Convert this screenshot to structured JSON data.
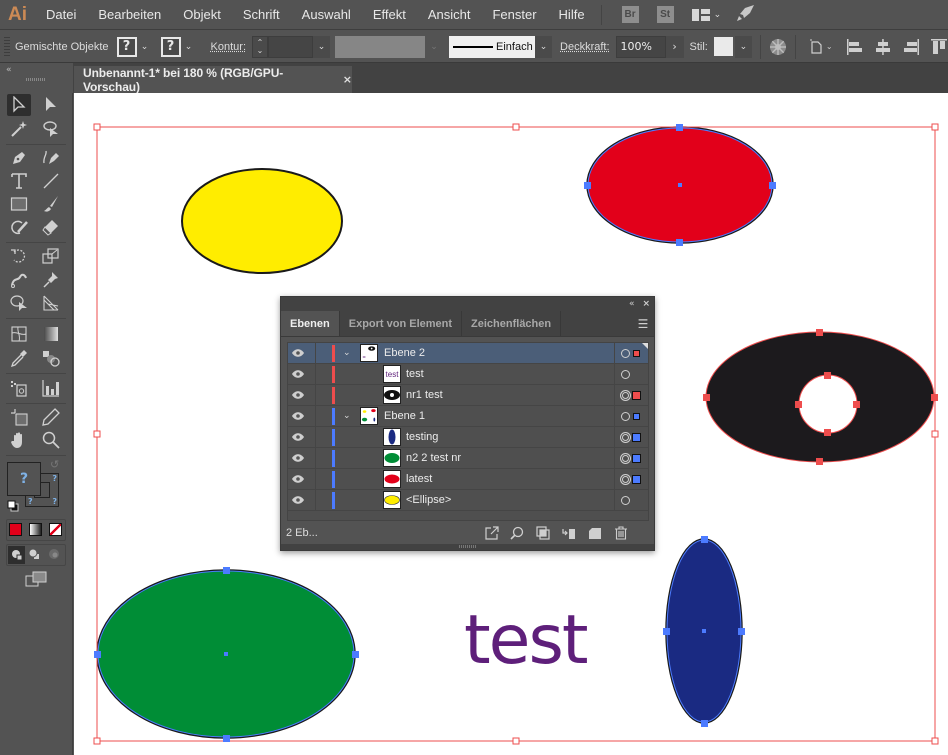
{
  "app": {
    "logo": "Ai"
  },
  "menu": [
    "Datei",
    "Bearbeiten",
    "Objekt",
    "Schrift",
    "Auswahl",
    "Effekt",
    "Ansicht",
    "Fenster",
    "Hilfe"
  ],
  "app_badges": {
    "bridge": "Br",
    "stock": "St"
  },
  "control_bar": {
    "selection_label": "Gemischte Objekte",
    "fill_value": "?",
    "stroke_value": "?",
    "stroke_label": "Kontur:",
    "stroke_weight": "",
    "stroke_profile": "Einfach",
    "opacity_label": "Deckkraft:",
    "opacity_value": "100%",
    "style_label": "Stil:"
  },
  "document_tab": {
    "title": "Unbenannt-1* bei 180 % (RGB/GPU-Vorschau)",
    "close": "×"
  },
  "toolbar": {
    "fill_stroke_value": "?",
    "fill_color": "#e2001a"
  },
  "canvas": {
    "text_object": "test",
    "text_color": "#5e1f7a",
    "colors": {
      "yellow": "#ffed00",
      "red": "#e2001a",
      "black": "#1c1a1d",
      "green": "#008d36",
      "blue": "#1a2a82",
      "layer2_selection": "#ee4d4d",
      "layer1_selection": "#4c7bff"
    }
  },
  "layers_panel": {
    "tabs": [
      "Ebenen",
      "Export von Element",
      "Zeichenflächen"
    ],
    "active_tab": "Ebenen",
    "layers": [
      {
        "name": "Ebene 2",
        "type": "layer",
        "expanded": true,
        "selected": true,
        "color": "#ee4d4d"
      },
      {
        "name": "test",
        "type": "sublayer",
        "color": "#ee4d4d"
      },
      {
        "name": "nr1 test",
        "type": "sublayer",
        "color": "#ee4d4d"
      },
      {
        "name": "Ebene 1",
        "type": "layer",
        "expanded": true,
        "color": "#4c7bff"
      },
      {
        "name": "testing",
        "type": "sublayer",
        "color": "#4c7bff"
      },
      {
        "name": "n2 2 test nr",
        "type": "sublayer",
        "color": "#4c7bff"
      },
      {
        "name": "latest",
        "type": "sublayer",
        "color": "#4c7bff"
      },
      {
        "name": "<Ellipse>",
        "type": "sublayer",
        "color": "#4c7bff"
      }
    ],
    "footer_count": "2 Eb...",
    "thumb_text": "test"
  }
}
